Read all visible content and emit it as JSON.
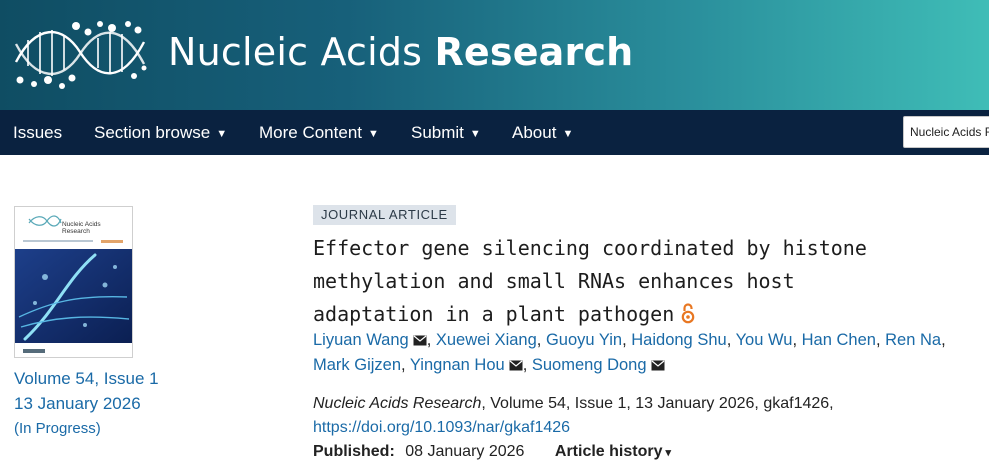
{
  "header": {
    "title_light": "Nucleic Acids ",
    "title_bold": "Research"
  },
  "nav": {
    "items": [
      {
        "label": "Issues",
        "has_caret": false
      },
      {
        "label": "Section browse",
        "has_caret": true
      },
      {
        "label": "More Content",
        "has_caret": true
      },
      {
        "label": "Submit",
        "has_caret": true
      },
      {
        "label": "About",
        "has_caret": true
      }
    ],
    "caret": "▼",
    "search_value": "Nucleic Acids R"
  },
  "cover": {
    "journal_line1": "Nucleic Acids",
    "journal_line2": "Research"
  },
  "issue": {
    "volume": "Volume 54, Issue 1",
    "date": "13 January 2026",
    "status": "(In Progress)"
  },
  "article": {
    "type": "JOURNAL ARTICLE",
    "title_lines": [
      "Effector gene silencing coordinated by histone",
      "methylation and small RNAs enhances host",
      "adaptation in a plant pathogen"
    ],
    "open_access_icon": "open-access-icon",
    "authors": [
      {
        "name": "Liyuan Wang",
        "email": true
      },
      {
        "name": "Xuewei Xiang",
        "email": false
      },
      {
        "name": "Guoyu Yin",
        "email": false
      },
      {
        "name": "Haidong Shu",
        "email": false
      },
      {
        "name": "You Wu",
        "email": false
      },
      {
        "name": "Han Chen",
        "email": false
      },
      {
        "name": "Ren Na",
        "email": false
      },
      {
        "name": "Mark Gijzen",
        "email": false
      },
      {
        "name": "Yingnan Hou",
        "email": true
      },
      {
        "name": "Suomeng Dong",
        "email": true
      }
    ],
    "citation_journal": "Nucleic Acids Research",
    "citation_rest": ", Volume 54, Issue 1, 13 January 2026, gkaf1426,",
    "doi": "https://doi.org/10.1093/nar/gkaf1426",
    "published_label": "Published:",
    "published_date": "08 January 2026",
    "history_label": "Article history",
    "history_caret": "▾"
  },
  "colors": {
    "nav_bg": "#0a2240",
    "link": "#1a6aa7",
    "oa_orange": "#e87722",
    "banner_start": "#0f4d63",
    "banner_end": "#3fbdb7"
  }
}
